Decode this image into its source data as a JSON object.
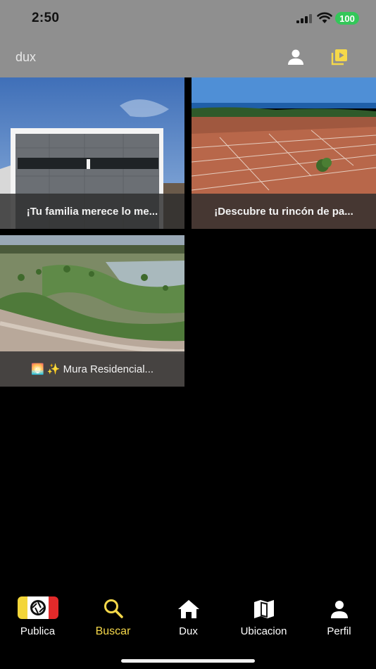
{
  "status_bar": {
    "time": "2:50",
    "battery": "100"
  },
  "header": {
    "title": "dux",
    "profile_icon": "person-icon",
    "video_icon": "video-library-icon"
  },
  "posts": [
    {
      "caption": "¡Tu familia merece lo me..."
    },
    {
      "caption": "¡Descubre tu rincón de pa..."
    },
    {
      "caption": "🌅 ✨ Mura Residencial..."
    }
  ],
  "tabs": [
    {
      "label": "Publica",
      "icon": "camera-shutter-icon"
    },
    {
      "label": "Buscar",
      "icon": "search-icon",
      "active": true
    },
    {
      "label": "Dux",
      "icon": "home-icon"
    },
    {
      "label": "Ubicacion",
      "icon": "map-icon"
    },
    {
      "label": "Perfil",
      "icon": "person-icon"
    }
  ],
  "colors": {
    "accent": "#f5d84a",
    "header_bg": "#8f8f8f",
    "background": "#000000"
  }
}
